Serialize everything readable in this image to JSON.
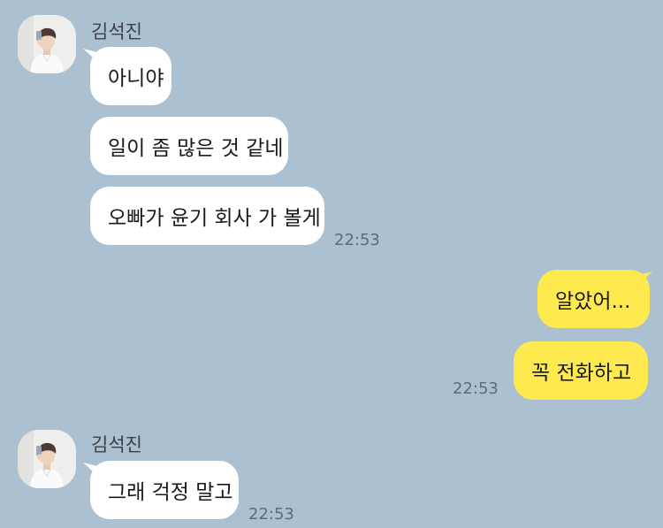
{
  "chat": {
    "colors": {
      "background": "#abc1d1",
      "incoming_bubble": "#ffffff",
      "outgoing_bubble": "#fee94e"
    },
    "group1": {
      "sender": "김석진",
      "avatar_icon": "profile-photo-icon",
      "messages": [
        "아니야",
        "일이 좀 많은 것 같네",
        "오빠가 윤기 회사 가 볼게"
      ],
      "time": "22:53"
    },
    "group2": {
      "messages": [
        "알았어...",
        "꼭 전화하고"
      ],
      "time": "22:53"
    },
    "group3": {
      "sender": "김석진",
      "avatar_icon": "profile-photo-icon",
      "messages": [
        "그래 걱정 말고"
      ],
      "time": "22:53"
    }
  }
}
